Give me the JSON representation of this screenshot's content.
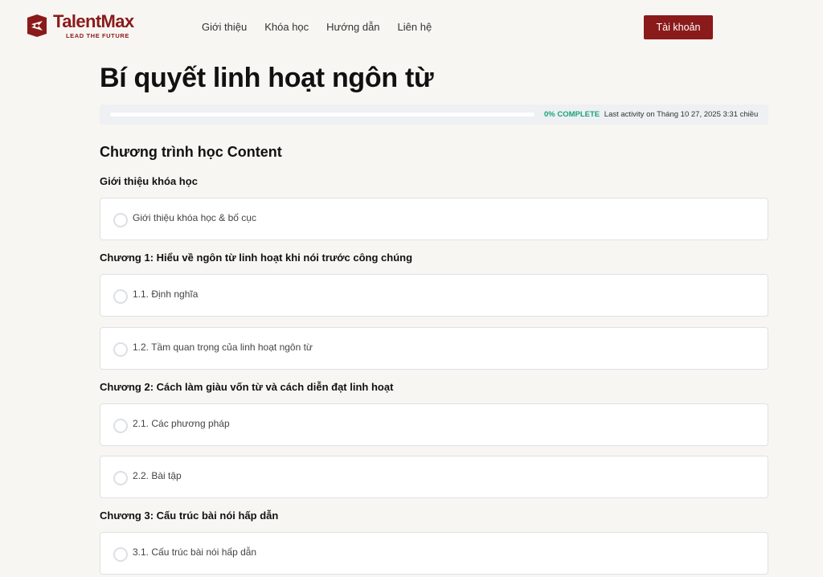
{
  "brand": {
    "name": "TalentMax",
    "tagline": "LEAD THE FUTURE",
    "color": "#8b1a1a"
  },
  "nav": {
    "items": [
      {
        "label": "Giới thiệu"
      },
      {
        "label": "Khóa học"
      },
      {
        "label": "Hướng dẫn"
      },
      {
        "label": "Liên hệ"
      }
    ],
    "account_label": "Tài khoản"
  },
  "course": {
    "title": "Bí quyết linh hoạt ngôn từ",
    "progress": {
      "percent": 0,
      "complete_label": "0% COMPLETE",
      "last_activity": "Last activity on Tháng 10 27, 2025 3:31 chiều",
      "accent_color": "#1aa37a"
    },
    "curriculum_title": "Chương trình học Content",
    "sections": [
      {
        "title": "Giới thiệu khóa học",
        "lessons": [
          {
            "label": "Giới thiệu khóa học & bố cục",
            "completed": false
          }
        ]
      },
      {
        "title": "Chương 1: Hiểu về ngôn từ linh hoạt khi nói trước công chúng",
        "lessons": [
          {
            "label": "1.1. Định nghĩa",
            "completed": false
          },
          {
            "label": "1.2. Tầm quan trọng của linh hoạt ngôn từ",
            "completed": false
          }
        ]
      },
      {
        "title": "Chương 2: Cách làm giàu vốn từ và cách diễn đạt linh hoạt",
        "lessons": [
          {
            "label": "2.1. Các phương pháp",
            "completed": false
          },
          {
            "label": "2.2. Bài tập",
            "completed": false
          }
        ]
      },
      {
        "title": "Chương 3: Cấu trúc bài nói hấp dẫn",
        "lessons": [
          {
            "label": "3.1. Cấu trúc bài nói hấp dẫn",
            "completed": false
          }
        ]
      }
    ]
  }
}
